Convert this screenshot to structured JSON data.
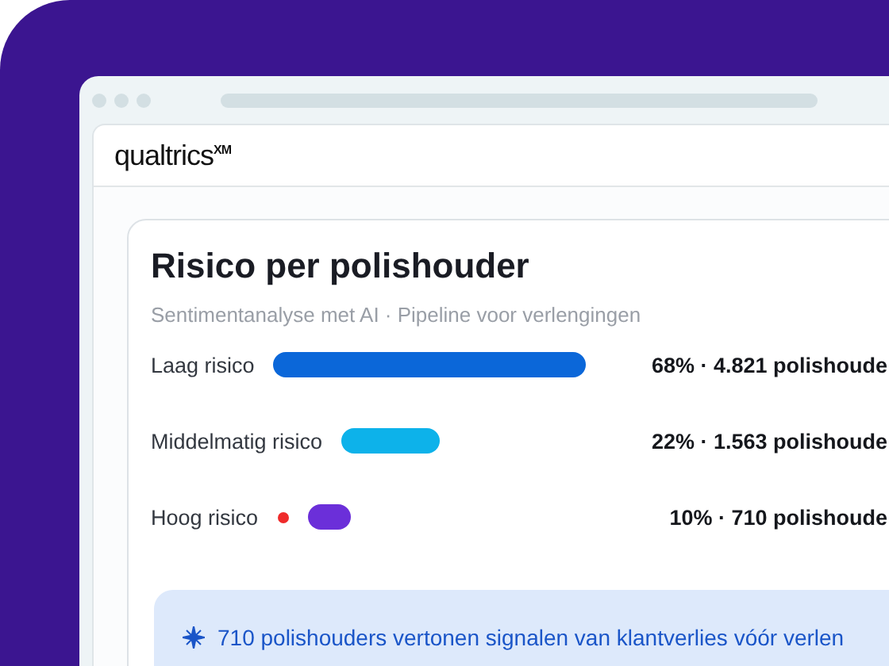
{
  "app": {
    "logo": "qualtrics$^{XM}$"
  },
  "card": {
    "title": "Risico per polishouder",
    "subtitle": "Sentimentanalyse met AI · Pipeline voor verlengingen",
    "rows": [
      {
        "label": "Laag risico",
        "alert": false,
        "color": "#0b67d9",
        "reading": "68% · 4.821 polishoude"
      },
      {
        "label": "Middelmatig risico",
        "alert": false,
        "color": "#0db2ea",
        "reading": "22% · 1.563 polishoude"
      },
      {
        "label": "Hoog risico",
        "alert": true,
        "color": "#6b2fd9",
        "reading": "10% · 710 polishoude"
      }
    ],
    "insight": "710 polishouders vertonen signalen van klantverlies vóór verlen"
  }
}
